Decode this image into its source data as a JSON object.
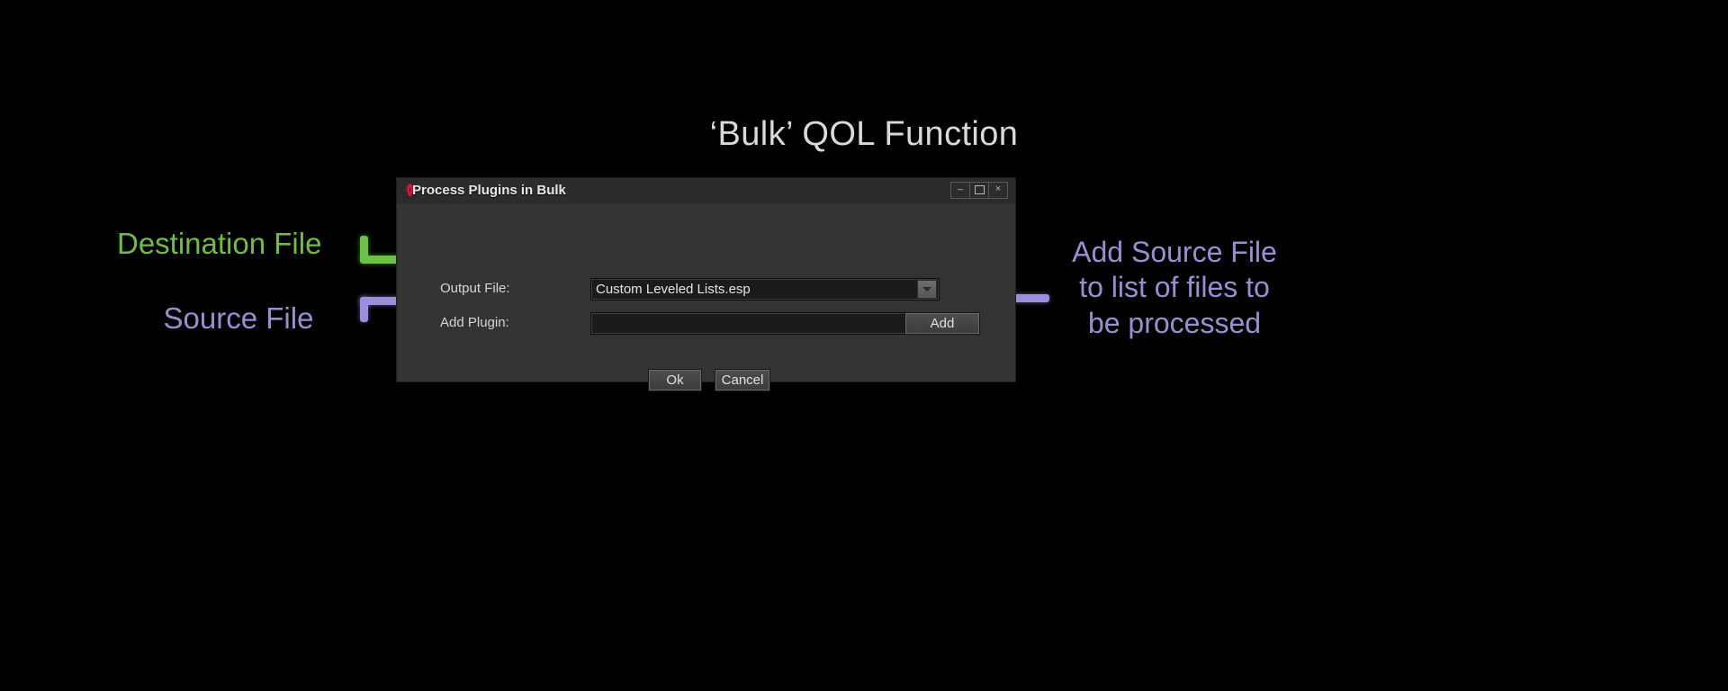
{
  "slide": {
    "title": "‘Bulk’ QOL Function",
    "background_color": "#000000",
    "title_color": "#d9d9d9"
  },
  "annotations": {
    "destination": {
      "text": "Destination File",
      "color": "#6fbd45",
      "connector_color": "#6cc248",
      "connector_icon": "elbow-arrow-icon"
    },
    "source": {
      "text": "Source File",
      "color": "#9a8ed2",
      "connector_color": "#9b8ede",
      "connector_icon": "elbow-arrow-icon"
    },
    "add_source": {
      "line1": "Add Source File",
      "line2": "to list of files to",
      "line3": "be processed",
      "color": "#9a8ed2",
      "connector_color": "#9b8ede",
      "connector_icon": "line-arrow-icon"
    }
  },
  "dialog": {
    "title": "Process Plugins in Bulk",
    "app_icon": "xedit-dragon-icon",
    "title_bar_color": "#2c2c2c",
    "body_color": "#333333",
    "window_controls": [
      {
        "name": "minimize",
        "icon": "minimize-icon",
        "glyph": "_"
      },
      {
        "name": "maximize",
        "icon": "maximize-icon",
        "glyph": ""
      },
      {
        "name": "close",
        "icon": "close-icon",
        "glyph": "×"
      }
    ],
    "fields": {
      "output_file": {
        "label": "Output File:",
        "value": "Custom Leveled Lists.esp",
        "placeholder": "",
        "dropdown_icon": "chevron-down-icon"
      },
      "add_plugin": {
        "label": "Add Plugin:",
        "value": "",
        "placeholder": "",
        "dropdown_icon": "chevron-down-icon"
      }
    },
    "buttons": {
      "add": "Add",
      "ok": "Ok",
      "cancel": "Cancel"
    }
  }
}
